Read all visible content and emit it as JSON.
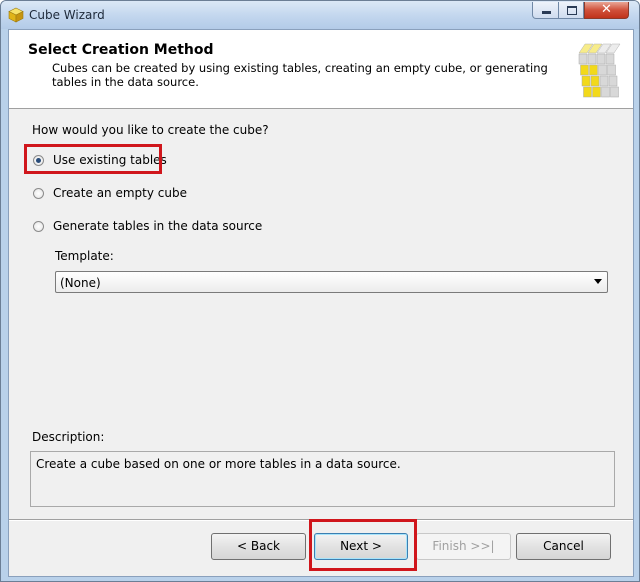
{
  "window": {
    "title": "Cube Wizard",
    "close_glyph": "✕"
  },
  "header": {
    "title": "Select Creation Method",
    "description": "Cubes can be created by using existing tables, creating an empty cube, or generating tables in the data source."
  },
  "options": {
    "question": "How would you like to create the cube?",
    "items": [
      {
        "label": "Use existing tables",
        "checked": true
      },
      {
        "label": "Create an empty cube",
        "checked": false
      },
      {
        "label": "Generate tables in the data source",
        "checked": false
      }
    ]
  },
  "template": {
    "label": "Template:",
    "selected": "(None)"
  },
  "description": {
    "label": "Description:",
    "text": "Create a cube based on one or more tables in a data source."
  },
  "buttons": {
    "back": "< Back",
    "next": "Next >",
    "finish": "Finish >>|",
    "cancel": "Cancel"
  },
  "colors": {
    "highlight": "#d0161c",
    "cube_yellow": "#f2d91a",
    "cube_gray": "#d8d8d8"
  },
  "icons": {
    "title": "cube-icon",
    "header": "cube-grid-icon"
  }
}
